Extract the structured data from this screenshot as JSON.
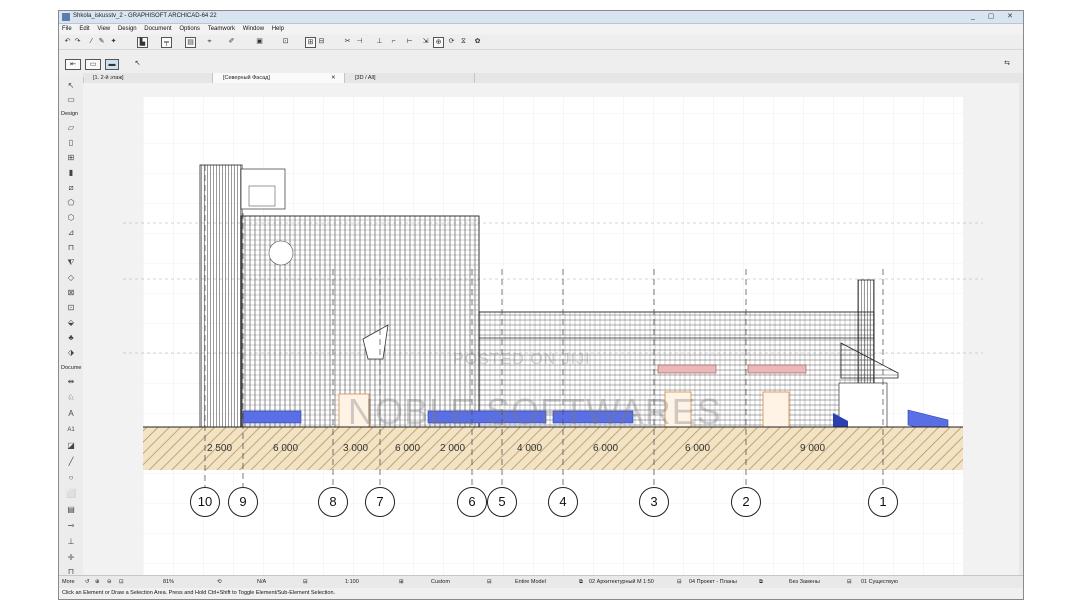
{
  "window": {
    "title": "Shkola_iskusstv_2 - GRAPHISOFT ARCHICAD-64 22",
    "minimize": "_",
    "maximize": "▢",
    "close": "✕"
  },
  "menu": [
    "File",
    "Edit",
    "View",
    "Design",
    "Document",
    "Options",
    "Teamwork",
    "Window",
    "Help"
  ],
  "tabs": [
    {
      "label": "[1. 2-й этаж]"
    },
    {
      "label": "[Северный Фасад]"
    },
    {
      "label": "[3D / All]"
    }
  ],
  "toolbox": {
    "design_label": "Design",
    "document_label": "Docume",
    "more_label": "More"
  },
  "drawing": {
    "axes": [
      "10",
      "9",
      "8",
      "7",
      "6",
      "5",
      "4",
      "3",
      "2",
      "1"
    ],
    "dimensions": [
      "2 500",
      "6 000",
      "3 000",
      "6 000",
      "2 000",
      "4 000",
      "6 000",
      "6 000",
      "9 000"
    ]
  },
  "watermark": {
    "posted": "POSTED ON JIJI",
    "brand": "NOBLE SOFTWARES"
  },
  "statusbar": {
    "zoom": "81%",
    "angle": "N/A",
    "scale": "1:100",
    "pen_set": "Custom",
    "model_view": "Entire Model",
    "layer_combo": "02 Архитектурный М 1:50",
    "dimension": "04 Проект - Планы",
    "override": "Без Замены",
    "renovation": "01 Существую"
  },
  "hint": "Click an Element or Draw a Selection Area. Press and Hold Ctrl+Shift to Toggle Element/Sub-Element Selection."
}
